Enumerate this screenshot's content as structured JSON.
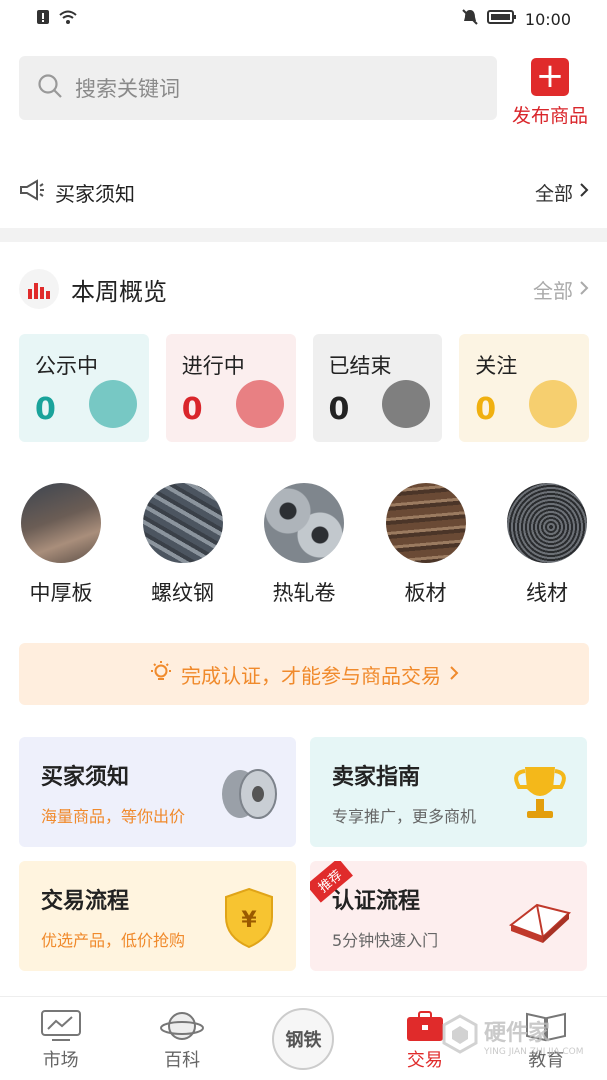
{
  "status_bar": {
    "time": "10:00"
  },
  "search": {
    "placeholder": "搜索关键词"
  },
  "publish": {
    "label": "发布商品"
  },
  "notice": {
    "title": "买家须知",
    "all": "全部"
  },
  "week": {
    "title": "本周概览",
    "all": "全部"
  },
  "stats": [
    {
      "label": "公示中",
      "value": "0",
      "color": "#1aa39b",
      "bg": "#e8f6f6"
    },
    {
      "label": "进行中",
      "value": "0",
      "color": "#d9262b",
      "bg": "#fbeeee"
    },
    {
      "label": "已结束",
      "value": "0",
      "color": "#222222",
      "bg": "#efefef"
    },
    {
      "label": "关注",
      "value": "0",
      "color": "#f0b010",
      "bg": "#fcf4e3"
    }
  ],
  "categories": [
    {
      "label": "中厚板"
    },
    {
      "label": "螺纹钢"
    },
    {
      "label": "热轧卷"
    },
    {
      "label": "板材"
    },
    {
      "label": "线材"
    }
  ],
  "auth_banner": {
    "text": "完成认证，才能参与商品交易"
  },
  "cards": [
    {
      "title": "买家须知",
      "subtitle": "海量商品，等你出价",
      "sub_color": "#f08a2c",
      "bg": "#eef0fb"
    },
    {
      "title": "卖家指南",
      "subtitle": "专享推广，更多商机",
      "sub_color": "#666666",
      "bg": "#e6f6f6"
    },
    {
      "title": "交易流程",
      "subtitle": "优选产品，低价抢购",
      "sub_color": "#f08a2c",
      "bg": "#fff4df"
    },
    {
      "title": "认证流程",
      "subtitle": "5分钟快速入门",
      "sub_color": "#666666",
      "bg": "#fdeeee",
      "ribbon": "推荐"
    }
  ],
  "tabs": [
    {
      "label": "市场"
    },
    {
      "label": "百科"
    },
    {
      "label": "钢铁"
    },
    {
      "label": "交易"
    },
    {
      "label": "教育"
    }
  ],
  "watermark": {
    "name": "硬件家",
    "sub": "YING JIAN ZHI JIA.COM"
  }
}
